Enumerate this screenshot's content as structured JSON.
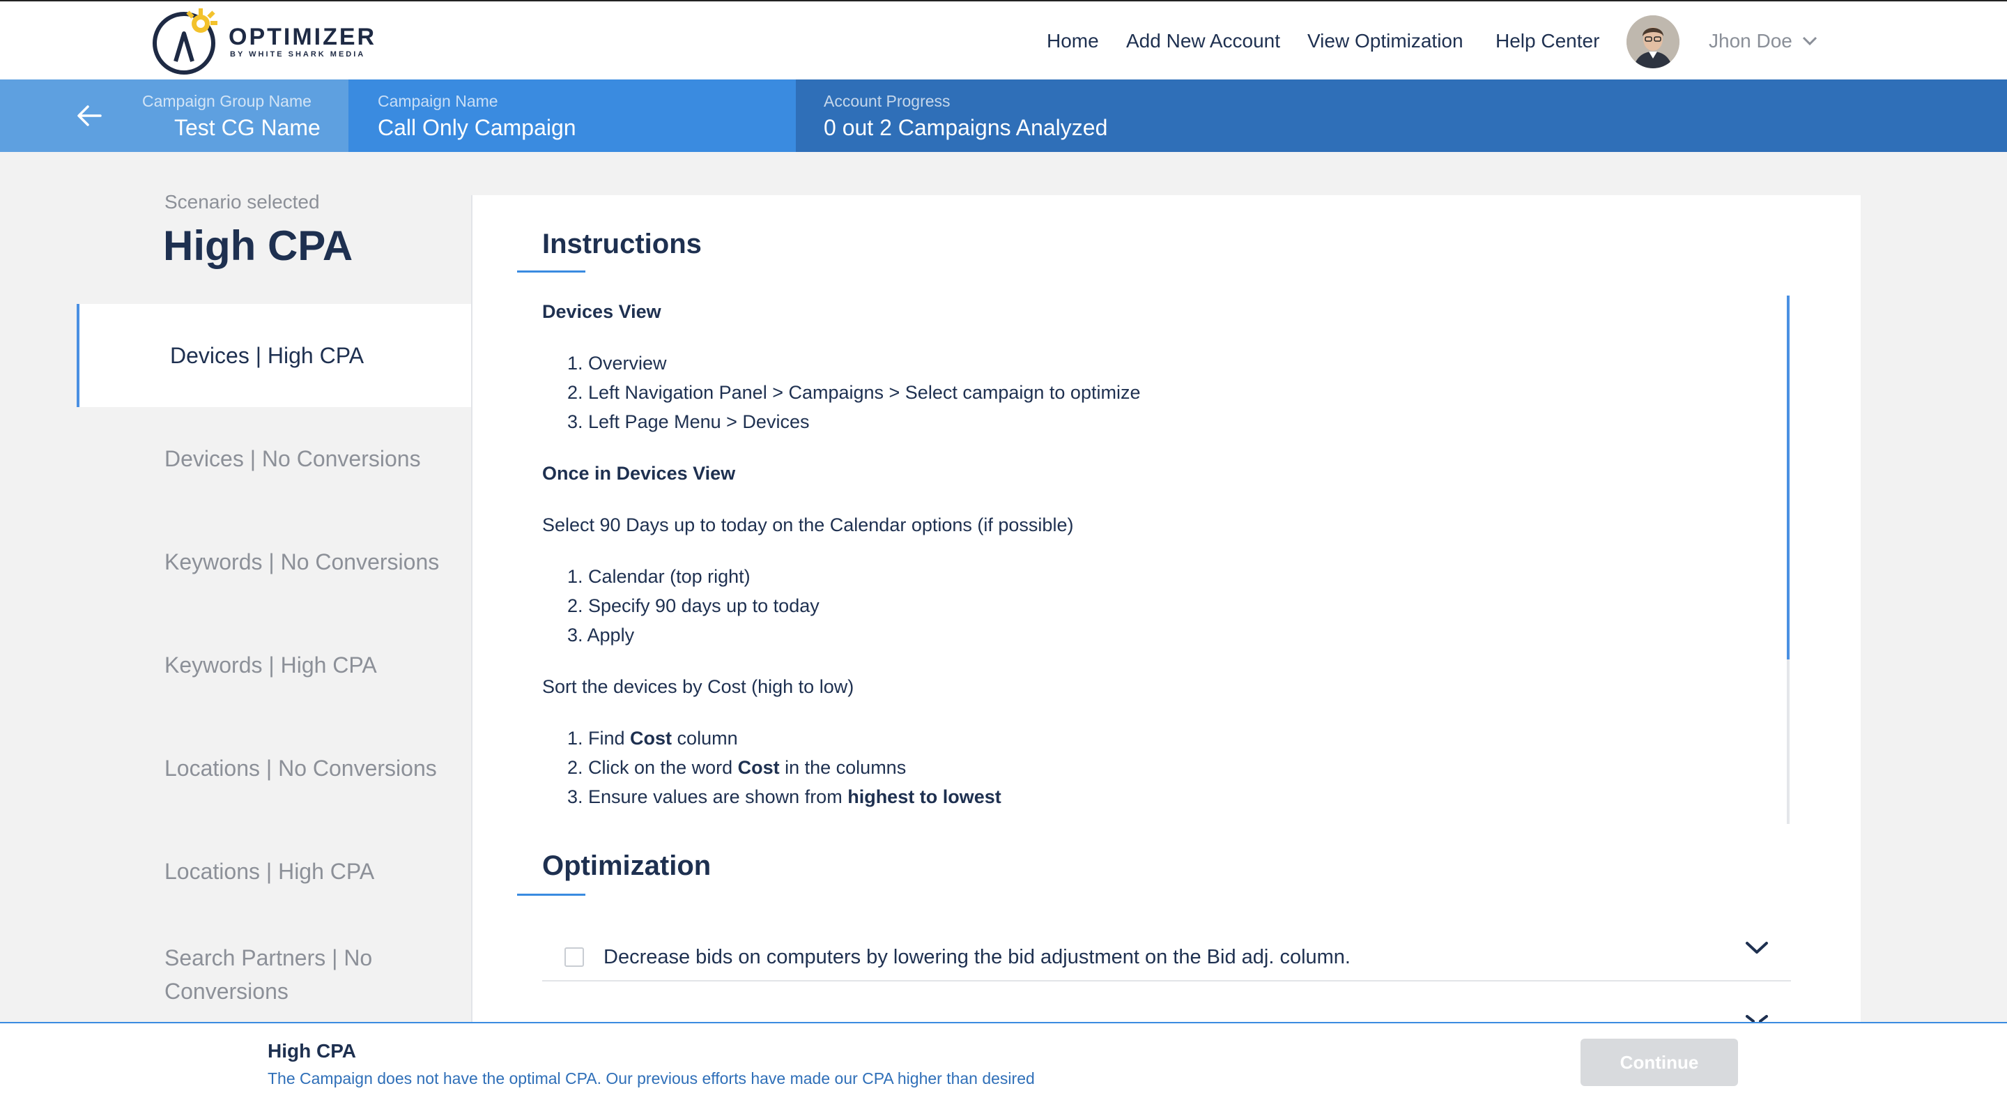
{
  "brand": {
    "name": "OPTIMIZER",
    "tagline": "BY WHITE SHARK MEDIA"
  },
  "nav": {
    "items": [
      "Home",
      "Add New Account",
      "View Optimization",
      "Help Center"
    ],
    "user_name": "Jhon Doe",
    "icons": {
      "avatar": "user-avatar",
      "dropdown": "chevron-down-icon"
    }
  },
  "campaign_strip": {
    "group_label": "Campaign Group Name",
    "group_value": "Test CG Name",
    "campaign_label": "Campaign Name",
    "campaign_value": "Call Only Campaign",
    "progress_label": "Account Progress",
    "progress_value": "0 out 2 Campaigns Analyzed"
  },
  "sidebar": {
    "scenario_label": "Scenario selected",
    "scenario_title": "High CPA",
    "items": [
      "Devices | High CPA",
      "Devices | No Conversions",
      "Keywords | No Conversions",
      "Keywords | High CPA",
      "Locations | No Conversions",
      "Locations | High CPA",
      "Search Partners | No Conversions"
    ],
    "active_index": 0
  },
  "instructions": {
    "title": "Instructions",
    "devices_heading": "Devices View",
    "devices_steps": [
      "1. Overview",
      "2. Left Navigation Panel > Campaigns > Select campaign to optimize",
      "3. Left Page Menu > Devices"
    ],
    "once_heading": "Once in Devices View",
    "select_text": "Select 90 Days up to today on the Calendar options (if possible)",
    "calendar_steps": [
      "1. Calendar (top right)",
      "2. Specify 90 days up to today",
      "3. Apply"
    ],
    "sort_text": "Sort the devices by Cost (high to low)",
    "sort_steps": [
      {
        "pre": "1. Find ",
        "bold": "Cost",
        "post": " column"
      },
      {
        "pre": "2. Click on the word ",
        "bold": "Cost",
        "post": " in the columns"
      },
      {
        "pre": "3. Ensure values are shown from ",
        "bold": "highest to lowest",
        "post": ""
      }
    ]
  },
  "optimization": {
    "title": "Optimization",
    "items": [
      "Decrease bids on computers by lowering the bid adjustment on the Bid adj. column."
    ]
  },
  "footer": {
    "title": "High CPA",
    "description": "The Campaign does not have the optimal CPA. Our previous efforts have made our CPA higher than desired",
    "continue_label": "Continue"
  },
  "colors": {
    "primary": "#2f6fb8",
    "accent": "#3a8be0",
    "light_accent": "#5ea0e0",
    "text_dark": "#1e3050",
    "text_muted": "#8c9098"
  }
}
